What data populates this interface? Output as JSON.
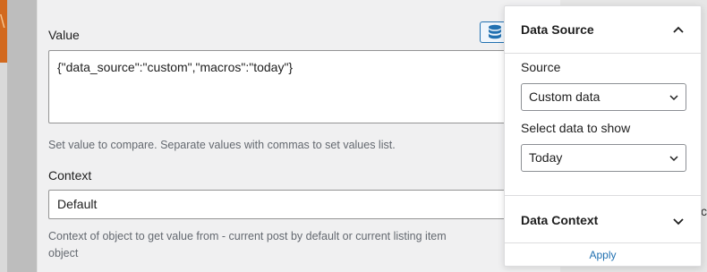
{
  "left_mark": "\\",
  "value_field": {
    "label": "Value",
    "content": "{\"data_source\":\"custom\",\"macros\":\"today\"}",
    "help": "Set value to compare. Separate values with commas to set values list."
  },
  "context_field": {
    "label": "Context",
    "selected": "Default",
    "help_line1": "Context of object to get value from - current post by default or current listing item",
    "help_line2": "object"
  },
  "popover": {
    "section_title": "Data Source",
    "source_label": "Source",
    "source_selected": "Custom data",
    "data_label": "Select data to show",
    "data_selected": "Today",
    "context_title": "Data Context",
    "apply_label": "Apply"
  },
  "right_edge_glyph": "c",
  "icons": {
    "database": "database-icon",
    "chevron_up": "chevron-up-icon",
    "chevron_down": "chevron-down-icon"
  },
  "colors": {
    "accent": "#2271b1",
    "orange": "#d2691e"
  }
}
